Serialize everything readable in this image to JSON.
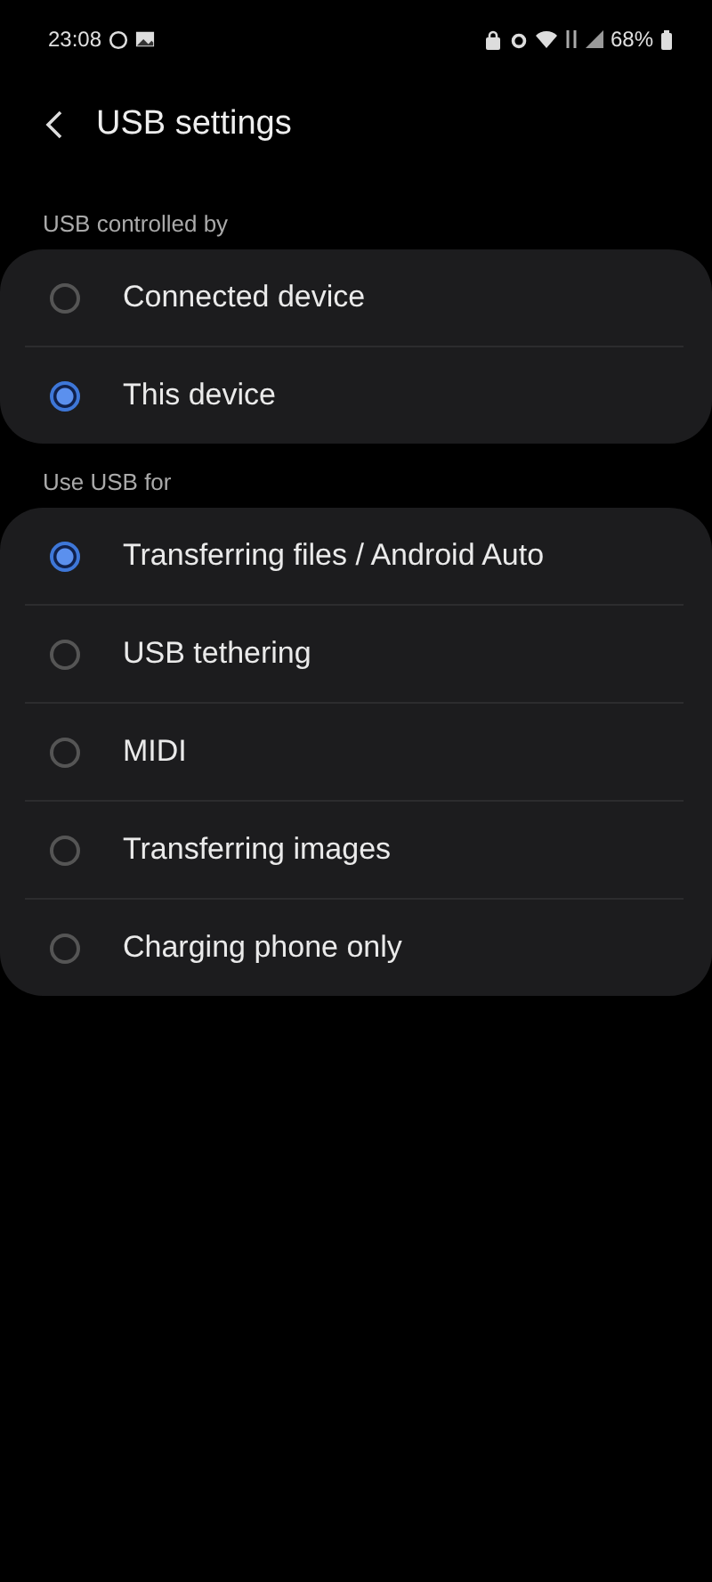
{
  "status_bar": {
    "time": "23:08",
    "battery": "68%"
  },
  "header": {
    "title": "USB settings"
  },
  "sections": [
    {
      "heading": "USB controlled by",
      "options": [
        {
          "label": "Connected device",
          "selected": false
        },
        {
          "label": "This device",
          "selected": true
        }
      ]
    },
    {
      "heading": "Use USB for",
      "options": [
        {
          "label": "Transferring files / Android Auto",
          "selected": true
        },
        {
          "label": "USB tethering",
          "selected": false
        },
        {
          "label": "MIDI",
          "selected": false
        },
        {
          "label": "Transferring images",
          "selected": false
        },
        {
          "label": "Charging phone only",
          "selected": false
        }
      ]
    }
  ]
}
